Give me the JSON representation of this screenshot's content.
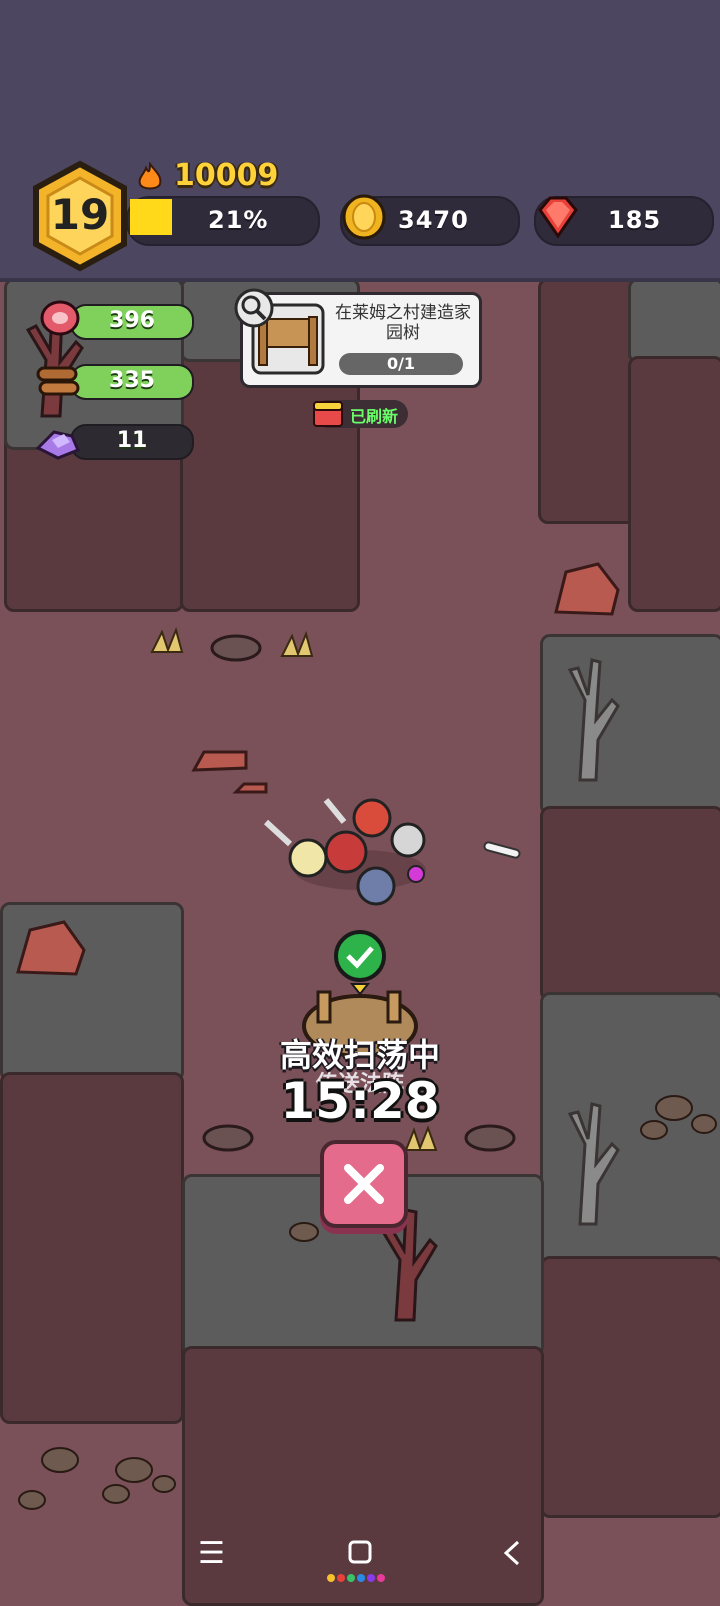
{
  "hud": {
    "level": "19",
    "power": "10009",
    "xp_percent_label": "21%",
    "xp_fraction": 0.21,
    "coins": "3470",
    "gems": "185"
  },
  "resources": {
    "meat": {
      "value": "396",
      "icon": "meat-icon"
    },
    "wood": {
      "value": "335",
      "icon": "wood-log-icon"
    },
    "ore": {
      "value": "11",
      "icon": "purple-ore-icon"
    }
  },
  "quest": {
    "title": "在莱姆之村建造家园树",
    "progress": "0/1",
    "icon": "building-sign-icon"
  },
  "refresh_badge": "已刷新",
  "sweep": {
    "status": "高效扫荡中",
    "portal_label": "传送法阵",
    "timer": "15:28"
  },
  "colors": {
    "topbar": "#4c4660",
    "ground": "#7a5158",
    "gold": "#ffd23a",
    "health_green": "#7fd15c",
    "close_pink": "#e46b8c"
  }
}
